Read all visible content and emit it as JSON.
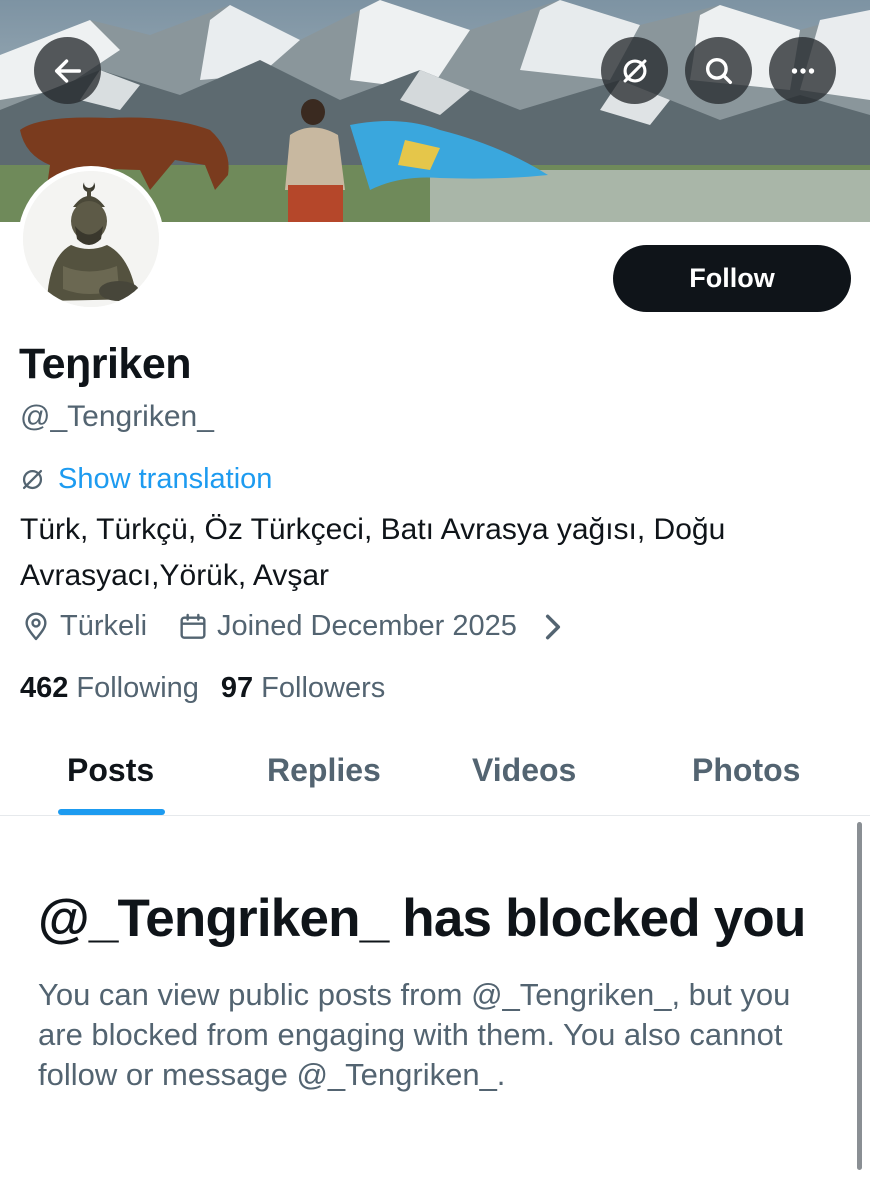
{
  "header": {
    "icons": [
      "back-arrow-icon",
      "translate-icon",
      "search-icon",
      "more-icon"
    ]
  },
  "profile": {
    "display_name": "Teŋriken",
    "handle": "@_Tengriken_",
    "follow_label": "Follow",
    "show_translation": "Show translation",
    "bio": "Türk, Türkçü, Öz Türkçeci, Batı Avrasya yağısı, Doğu Avrasyacı,Yörük, Avşar",
    "location": "Türkeli",
    "joined": "Joined December 2025",
    "following_count": "462",
    "following_label": "Following",
    "followers_count": "97",
    "followers_label": "Followers"
  },
  "tabs": [
    {
      "label": "Posts",
      "active": true
    },
    {
      "label": "Replies",
      "active": false
    },
    {
      "label": "Videos",
      "active": false
    },
    {
      "label": "Photos",
      "active": false
    }
  ],
  "blocked": {
    "title": "@_Tengriken_ has blocked you",
    "message": "You can view public posts from @_Tengriken_, but you are blocked from engaging with them. You also cannot follow or message @_Tengriken_."
  },
  "colors": {
    "accent": "#1d9bf0",
    "text": "#0f1419",
    "secondary": "#536471",
    "button": "#0f1419"
  }
}
